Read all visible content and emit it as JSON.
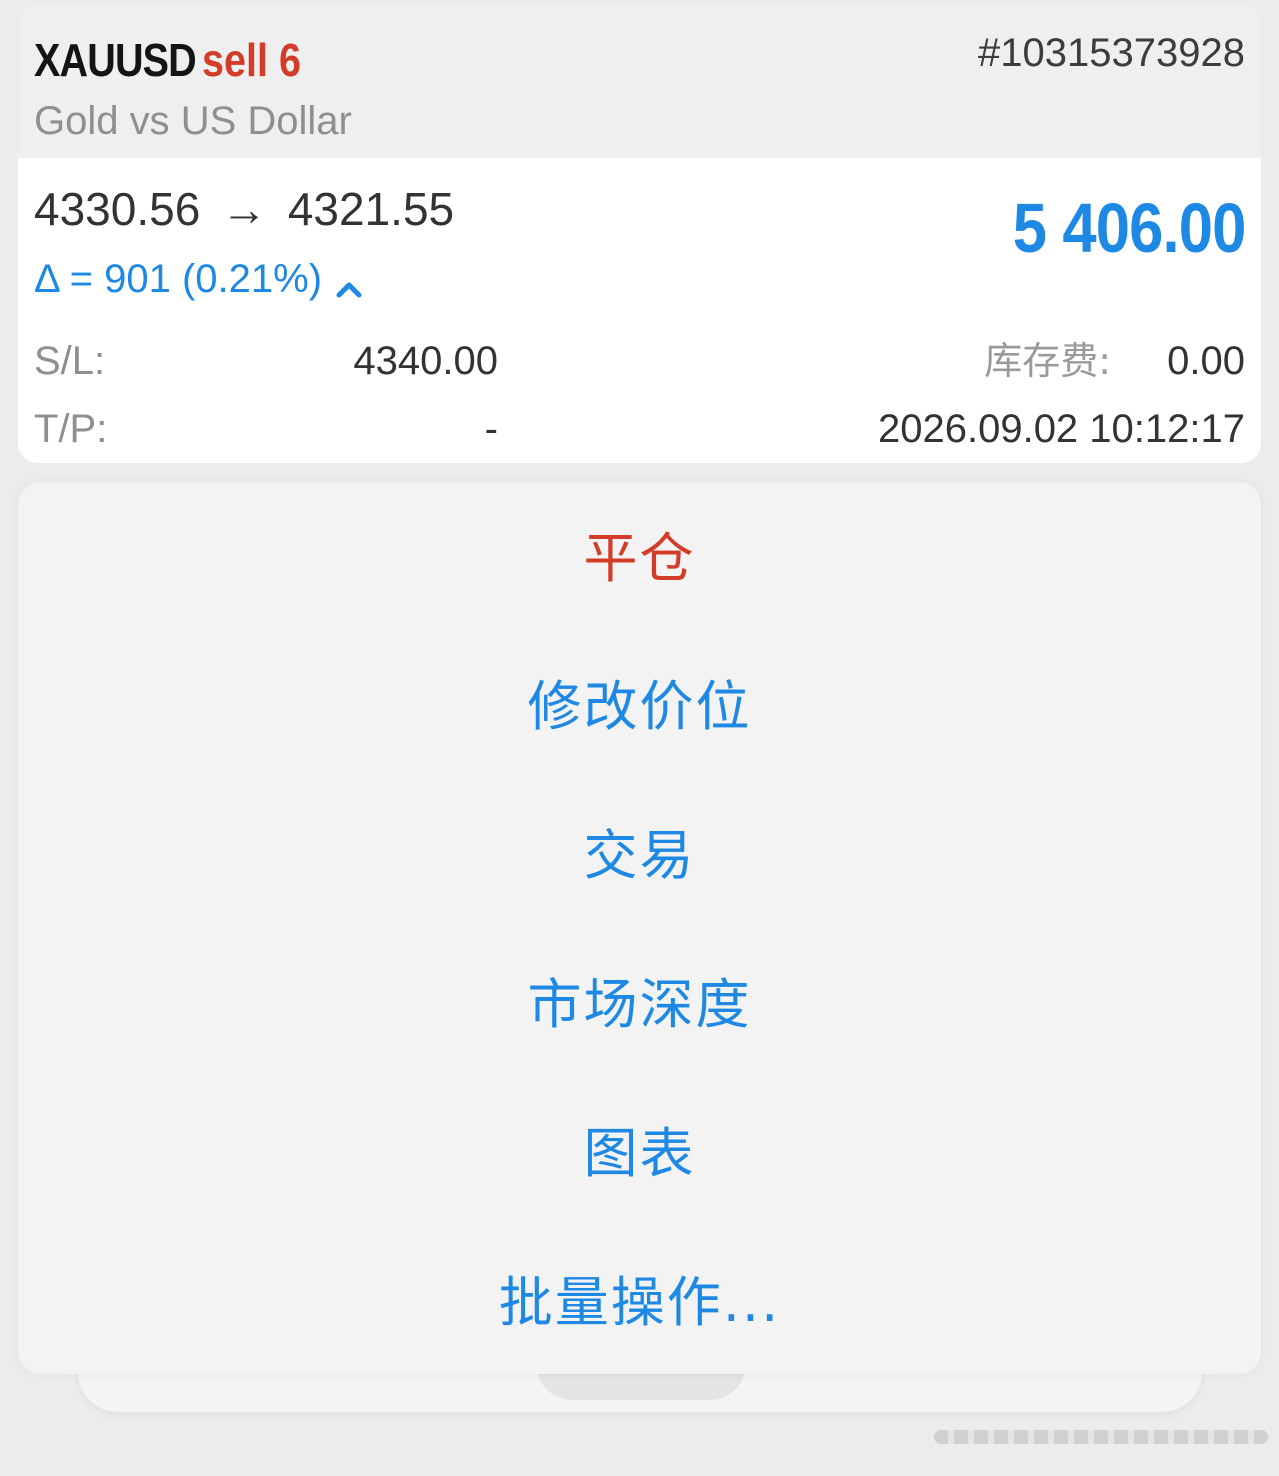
{
  "position": {
    "symbol": "XAUUSD",
    "side_volume": "sell 6",
    "ticket": "#10315373928",
    "description": "Gold vs US Dollar",
    "open_price": "4330.56",
    "arrow": "→",
    "current_price": "4321.55",
    "delta_text": "Δ = 901 (0.21%)",
    "delta_direction_icon": "chevron-up-icon",
    "profit": "5 406.00",
    "sl_label": "S/L:",
    "sl_value": "4340.00",
    "tp_label": "T/P:",
    "tp_value": "-",
    "swap_label": "库存费:",
    "swap_value": "0.00",
    "open_time": "2026.09.02 10:12:17"
  },
  "menu": {
    "items": [
      {
        "label": "平仓",
        "style": "destructive"
      },
      {
        "label": "修改价位",
        "style": "default"
      },
      {
        "label": "交易",
        "style": "default"
      },
      {
        "label": "市场深度",
        "style": "default"
      },
      {
        "label": "图表",
        "style": "default"
      },
      {
        "label": "批量操作...",
        "style": "default"
      }
    ]
  },
  "colors": {
    "accent_blue": "#1e88e5",
    "sell_red": "#d23c28",
    "text_dark": "#333333",
    "text_muted": "#8f8f8f"
  }
}
